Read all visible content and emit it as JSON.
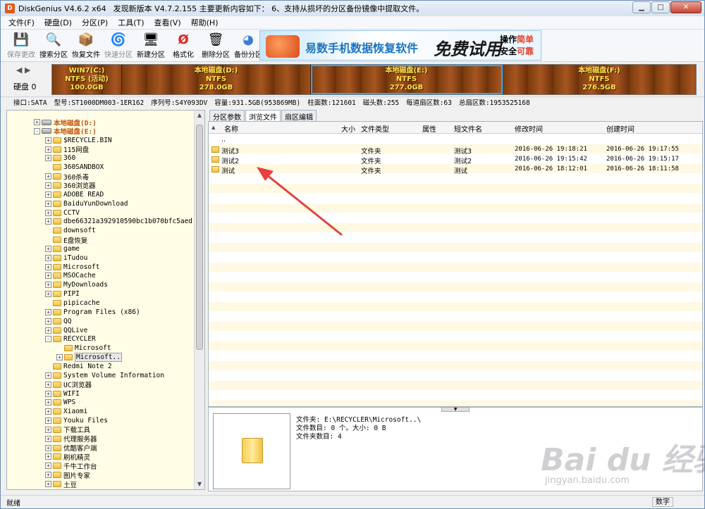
{
  "window": {
    "app_name": "DiskGenius V4.6.2 x64",
    "notice": "发现新版本 V4.7.2.155 主要更新内容如下：  6、支持从损坏的分区备份镜像中提取文件。",
    "min_label": "▁",
    "max_label": "□",
    "close_label": "✕",
    "icon_letter": "D"
  },
  "menu": {
    "items": [
      "文件(F)",
      "硬盘(D)",
      "分区(P)",
      "工具(T)",
      "查看(V)",
      "帮助(H)"
    ]
  },
  "toolbar": {
    "buttons": [
      {
        "label": "保存更改",
        "icon": "save-disk-icon",
        "glyph": "💾",
        "enabled": false
      },
      {
        "label": "搜索分区",
        "icon": "search-partition-icon",
        "glyph": "🔍",
        "enabled": true
      },
      {
        "label": "恢复文件",
        "icon": "recover-files-icon",
        "glyph": "📦",
        "enabled": true
      },
      {
        "label": "快速分区",
        "icon": "quick-partition-icon",
        "glyph": "🌀",
        "enabled": false
      },
      {
        "label": "新建分区",
        "icon": "new-partition-icon",
        "glyph": "🖥",
        "enabled": true
      },
      {
        "label": "格式化",
        "icon": "format-icon",
        "glyph": "Ø",
        "enabled": true
      },
      {
        "label": "删除分区",
        "icon": "delete-partition-icon",
        "glyph": "🗑",
        "enabled": true
      },
      {
        "label": "备份分区",
        "icon": "backup-partition-icon",
        "glyph": "◕",
        "enabled": true
      }
    ],
    "ad": {
      "text": "易数手机数据恢复软件",
      "big": "免费试用",
      "right_line1_a": "操作",
      "right_line1_b": "简单",
      "right_line2_a": "安全",
      "right_line2_b": "可靠",
      "accent": "#e8402a"
    }
  },
  "diskmap": {
    "disk_label": "硬盘 0",
    "nav": "◀ ▶",
    "partitions": [
      {
        "name": "WIN7(C:)",
        "fs": "NTFS (活动)",
        "size": "100.0GB",
        "selected": false
      },
      {
        "name": "本地磁盘(D:)",
        "fs": "NTFS",
        "size": "278.0GB",
        "selected": false
      },
      {
        "name": "本地磁盘(E:)",
        "fs": "NTFS",
        "size": "277.0GB",
        "selected": true
      },
      {
        "name": "本地磁盘(F:)",
        "fs": "NTFS",
        "size": "276.5GB",
        "selected": false
      }
    ]
  },
  "diskinfo": {
    "interface": "接口:SATA",
    "model": "型号:ST1000DM003-1ER162",
    "serial": "序列号:S4Y093DV",
    "capacity": "容量:931.5GB(953869MB)",
    "cylinders": "柱面数:121601",
    "heads": "磁头数:255",
    "sectors_per_track": "每道扇区数:63",
    "total_sectors": "总扇区数:1953525168"
  },
  "tree": {
    "items": [
      {
        "label": "本地磁盘(D:)",
        "type": "drive",
        "level": 0,
        "exp": "+"
      },
      {
        "label": "本地磁盘(E:)",
        "type": "drive",
        "level": 0,
        "exp": "-"
      },
      {
        "label": "$RECYCLE.BIN",
        "type": "folder",
        "level": 1,
        "exp": "+"
      },
      {
        "label": "115网盘",
        "type": "folder",
        "level": 1,
        "exp": "+"
      },
      {
        "label": "360",
        "type": "folder",
        "level": 1,
        "exp": "+"
      },
      {
        "label": "360SANDBOX",
        "type": "folder",
        "level": 1,
        "exp": ""
      },
      {
        "label": "360杀毒",
        "type": "folder",
        "level": 1,
        "exp": "+"
      },
      {
        "label": "360浏览器",
        "type": "folder",
        "level": 1,
        "exp": "+"
      },
      {
        "label": "ADOBE READ",
        "type": "folder",
        "level": 1,
        "exp": "+"
      },
      {
        "label": "BaiduYunDownload",
        "type": "folder",
        "level": 1,
        "exp": "+"
      },
      {
        "label": "CCTV",
        "type": "folder",
        "level": 1,
        "exp": "+"
      },
      {
        "label": "dbe66321a392910590bc1b070bfc5aed",
        "type": "folder",
        "level": 1,
        "exp": "+"
      },
      {
        "label": "downsoft",
        "type": "folder",
        "level": 1,
        "exp": ""
      },
      {
        "label": "E盘恢复",
        "type": "folder",
        "level": 1,
        "exp": ""
      },
      {
        "label": "game",
        "type": "folder",
        "level": 1,
        "exp": "+"
      },
      {
        "label": "iTudou",
        "type": "folder",
        "level": 1,
        "exp": "+"
      },
      {
        "label": "Microsoft",
        "type": "folder",
        "level": 1,
        "exp": "+"
      },
      {
        "label": "MSOCache",
        "type": "folder",
        "level": 1,
        "exp": "+"
      },
      {
        "label": "MyDownloads",
        "type": "folder",
        "level": 1,
        "exp": "+"
      },
      {
        "label": "PIPI",
        "type": "folder",
        "level": 1,
        "exp": "+"
      },
      {
        "label": "pipicache",
        "type": "folder",
        "level": 1,
        "exp": ""
      },
      {
        "label": "Program Files (x86)",
        "type": "folder",
        "level": 1,
        "exp": "+"
      },
      {
        "label": "QQ",
        "type": "folder",
        "level": 1,
        "exp": "+"
      },
      {
        "label": "QQLive",
        "type": "folder",
        "level": 1,
        "exp": "+"
      },
      {
        "label": "RECYCLER",
        "type": "folder",
        "level": 1,
        "exp": "-"
      },
      {
        "label": "Microsoft",
        "type": "folder",
        "level": 2,
        "exp": ""
      },
      {
        "label": "Microsoft..",
        "type": "folder",
        "level": 2,
        "exp": "+",
        "highlight": true
      },
      {
        "label": "Redmi Note 2",
        "type": "folder",
        "level": 1,
        "exp": ""
      },
      {
        "label": "System Volume Information",
        "type": "folder",
        "level": 1,
        "exp": "+"
      },
      {
        "label": "UC浏览器",
        "type": "folder",
        "level": 1,
        "exp": "+"
      },
      {
        "label": "WIFI",
        "type": "folder",
        "level": 1,
        "exp": "+"
      },
      {
        "label": "WPS",
        "type": "folder",
        "level": 1,
        "exp": "+"
      },
      {
        "label": "Xiaomi",
        "type": "folder",
        "level": 1,
        "exp": "+"
      },
      {
        "label": "Youku Files",
        "type": "folder",
        "level": 1,
        "exp": "+"
      },
      {
        "label": "下载工具",
        "type": "folder",
        "level": 1,
        "exp": "+"
      },
      {
        "label": "代理服务器",
        "type": "folder",
        "level": 1,
        "exp": "+"
      },
      {
        "label": "优酷客户端",
        "type": "folder",
        "level": 1,
        "exp": "+"
      },
      {
        "label": "刷机精灵",
        "type": "folder",
        "level": 1,
        "exp": "+"
      },
      {
        "label": "千牛工作台",
        "type": "folder",
        "level": 1,
        "exp": "+"
      },
      {
        "label": "图片专家",
        "type": "folder",
        "level": 1,
        "exp": "+"
      },
      {
        "label": "土豆",
        "type": "folder",
        "level": 1,
        "exp": "+"
      }
    ]
  },
  "tabs": [
    "分区参数",
    "浏览文件",
    "扇区编辑"
  ],
  "active_tab": 1,
  "filelist": {
    "headers": {
      "name": "名称",
      "size": "大小",
      "type": "文件类型",
      "attr": "属性",
      "short": "短文件名",
      "modified": "修改时间",
      "created": "创建时间"
    },
    "parent": "..",
    "rows": [
      {
        "name": "测试3",
        "type": "文件夹",
        "short": "测试3",
        "modified": "2016-06-26 19:18:21",
        "created": "2016-06-26 19:17:55"
      },
      {
        "name": "测试2",
        "type": "文件夹",
        "short": "测试2",
        "modified": "2016-06-26 19:15:42",
        "created": "2016-06-26 19:15:17"
      },
      {
        "name": "测试",
        "type": "文件夹",
        "short": "测试",
        "modified": "2016-06-26 18:12:01",
        "created": "2016-06-26 18:11:58"
      }
    ]
  },
  "details": {
    "line1": "文件夹: E:\\RECYCLER\\Microsoft..\\",
    "line2": "文件数目: 0 个。大小: 0 B",
    "line3": "文件夹数目: 4"
  },
  "status": {
    "left": "就绪",
    "right": "数字"
  },
  "watermark": {
    "big": "Bai du 经验",
    "small": "jingyan.baidu.com"
  },
  "colors": {
    "partition_text": "#ffe34d",
    "selected_outline": "#2aa6ff",
    "arrow": "#e8403a",
    "drive_label": "#c2540f"
  }
}
